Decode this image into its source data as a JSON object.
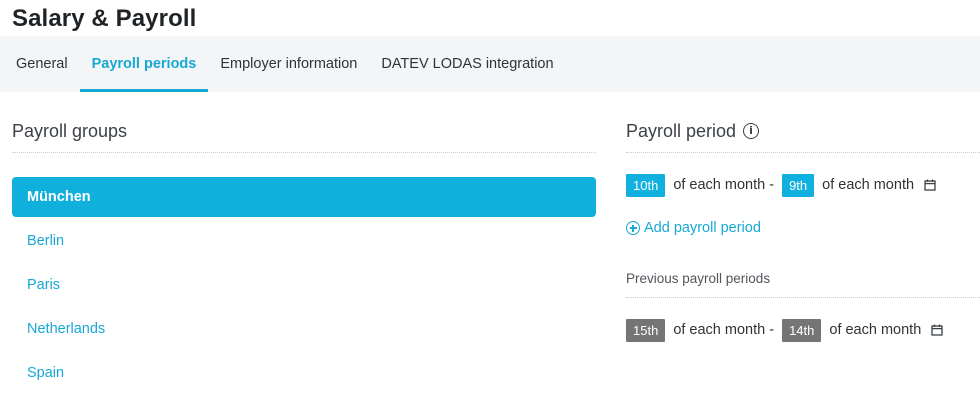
{
  "header": {
    "title": "Salary & Payroll"
  },
  "tabs": [
    {
      "label": "General",
      "active": false
    },
    {
      "label": "Payroll periods",
      "active": true
    },
    {
      "label": "Employer information",
      "active": false
    },
    {
      "label": "DATEV LODAS integration",
      "active": false
    }
  ],
  "payroll_groups": {
    "title": "Payroll groups",
    "items": [
      {
        "label": "München",
        "active": true
      },
      {
        "label": "Berlin",
        "active": false
      },
      {
        "label": "Paris",
        "active": false
      },
      {
        "label": "Netherlands",
        "active": false
      },
      {
        "label": "Spain",
        "active": false
      }
    ]
  },
  "payroll_period": {
    "title": "Payroll period",
    "info_icon": "info-icon",
    "current": {
      "start": "10th",
      "middle_text": "of each month -",
      "end": "9th",
      "end_text": "of each month",
      "icon": "calendar-icon"
    },
    "add_label": "Add payroll period",
    "previous_title": "Previous payroll periods",
    "previous": [
      {
        "start": "15th",
        "middle_text": "of each month -",
        "end": "14th",
        "end_text": "of each month",
        "icon": "calendar-icon"
      }
    ]
  },
  "colors": {
    "accent": "#17a8d6",
    "active_bg": "#0fb0dc",
    "chip_gray": "#757575",
    "tabbar_bg": "#f4f5f6"
  }
}
